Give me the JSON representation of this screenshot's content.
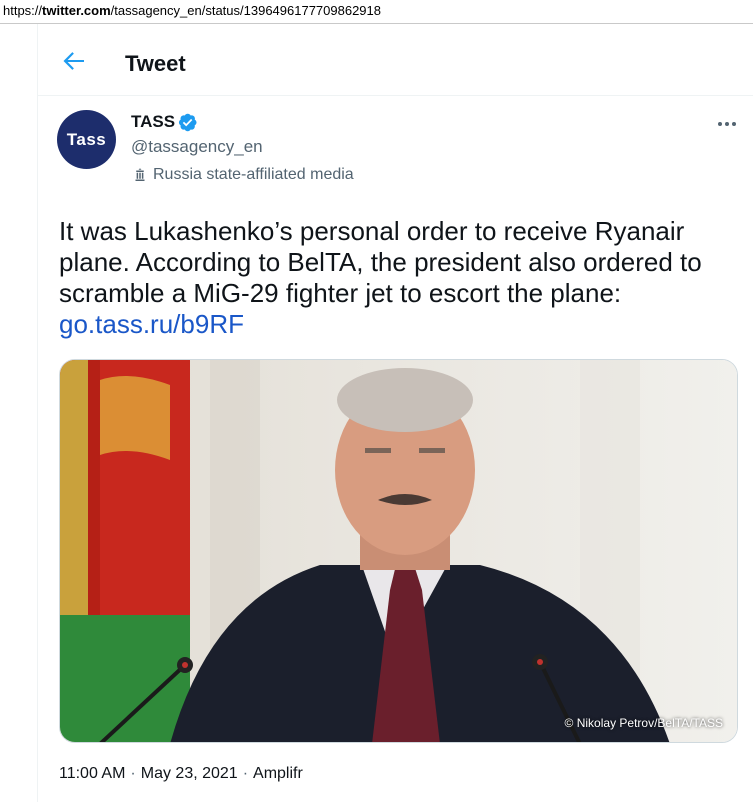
{
  "browser": {
    "url_prefix": "https://",
    "url_host": "twitter.com",
    "url_path": "/tassagency_en/status/1396496177709862918"
  },
  "header": {
    "title": "Tweet"
  },
  "author": {
    "avatar_text": "Tass",
    "display_name": "TASS",
    "handle": "@tassagency_en",
    "label": "Russia state-affiliated media",
    "verified": true
  },
  "tweet": {
    "text": "It was Lukashenko’s personal order to receive Ryanair plane. According to BelTA, the president also ordered to scramble a MiG-29 fighter jet to escort the plane: ",
    "link": "go.tass.ru/b9RF",
    "photo_credit": "© Nikolay Petrov/BelTA/TASS"
  },
  "meta": {
    "time": "11:00 AM",
    "date": "May 23, 2021",
    "source": "Amplifr"
  },
  "colors": {
    "link": "#1a57c8",
    "verified": "#1d9bf0",
    "back_arrow": "#1d9bf0",
    "avatar_bg": "#1d2d6c"
  },
  "icons": [
    "back-arrow-icon",
    "verified-badge-icon",
    "government-building-icon",
    "more-options-icon"
  ]
}
